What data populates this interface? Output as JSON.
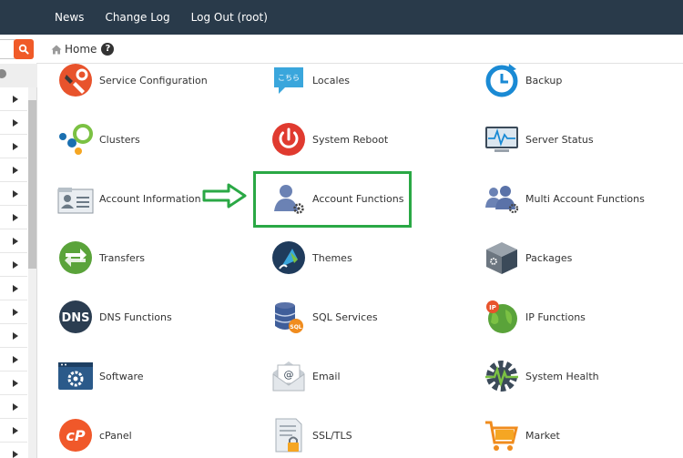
{
  "topbar": {
    "links": [
      "News",
      "Change Log",
      "Log Out (root)"
    ]
  },
  "breadcrumb": {
    "home_label": "Home",
    "help_glyph": "?"
  },
  "colors": {
    "topbar": "#293a4a",
    "search_button": "#f05a28",
    "highlight": "#2aa845"
  },
  "items": [
    {
      "label": "Service Configuration",
      "icon": "service-configuration-icon"
    },
    {
      "label": "Locales",
      "icon": "locales-icon"
    },
    {
      "label": "Backup",
      "icon": "backup-icon"
    },
    {
      "label": "Clusters",
      "icon": "clusters-icon"
    },
    {
      "label": "System Reboot",
      "icon": "system-reboot-icon"
    },
    {
      "label": "Server Status",
      "icon": "server-status-icon"
    },
    {
      "label": "Account Information",
      "icon": "account-information-icon"
    },
    {
      "label": "Account Functions",
      "icon": "account-functions-icon"
    },
    {
      "label": "Multi Account Functions",
      "icon": "multi-account-functions-icon"
    },
    {
      "label": "Transfers",
      "icon": "transfers-icon"
    },
    {
      "label": "Themes",
      "icon": "themes-icon"
    },
    {
      "label": "Packages",
      "icon": "packages-icon"
    },
    {
      "label": "DNS Functions",
      "icon": "dns-functions-icon"
    },
    {
      "label": "SQL Services",
      "icon": "sql-services-icon"
    },
    {
      "label": "IP Functions",
      "icon": "ip-functions-icon"
    },
    {
      "label": "Software",
      "icon": "software-icon"
    },
    {
      "label": "Email",
      "icon": "email-icon"
    },
    {
      "label": "System Health",
      "icon": "system-health-icon"
    },
    {
      "label": "cPanel",
      "icon": "cpanel-icon"
    },
    {
      "label": "SSL/TLS",
      "icon": "ssl-tls-icon"
    },
    {
      "label": "Market",
      "icon": "market-icon"
    }
  ],
  "icon_text": {
    "locales": "こちら",
    "dns": "DNS",
    "sql": "SQL",
    "ip": "IP",
    "cpanel": "cP",
    "email_at": "@"
  }
}
